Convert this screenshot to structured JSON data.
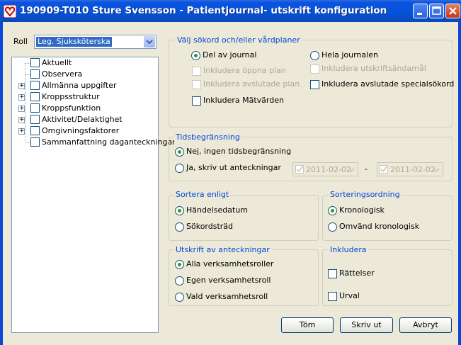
{
  "window": {
    "title": "190909-T010 Sture Svensson - Patientjournal- utskrift konfiguration"
  },
  "roll": {
    "label": "Roll",
    "selected": "Leg. Sjuksköterska"
  },
  "tree": {
    "items": [
      {
        "label": "Aktuellt",
        "expandable": false
      },
      {
        "label": "Observera",
        "expandable": false
      },
      {
        "label": "Allmänna uppgifter",
        "expandable": true
      },
      {
        "label": "Kroppsstruktur",
        "expandable": true
      },
      {
        "label": "Kroppsfunktion",
        "expandable": true
      },
      {
        "label": "Aktivitet/Delaktighet",
        "expandable": true
      },
      {
        "label": "Omgivningsfaktorer",
        "expandable": true
      },
      {
        "label": "Sammanfattning daganteckningar",
        "expandable": false
      }
    ]
  },
  "valj": {
    "title": "Välj sökord och/eller vårdplaner",
    "del_av_journal": "Del av journal",
    "hela_journalen": "Hela journalen",
    "inkl_oppna_plan": "Inkludera öppna plan",
    "inkl_utskriftsandamal": "Inkludera utskriftsändamål",
    "inkl_avslutade_plan": "Inkludera avslutade plan",
    "inkl_avslutade_specialsokord": "Inkludera avslutade specialsökord",
    "inkl_matvarden": "Inkludera Mätvärden"
  },
  "tid": {
    "title": "Tidsbegränsning",
    "nej": "Nej, ingen tidsbegränsning",
    "ja": "Ja, skriv ut anteckningar",
    "from_date": "2011-02-02",
    "dash": "-",
    "to_date": "2011-02-02"
  },
  "sortera": {
    "title": "Sortera enligt",
    "handelsedatum": "Händelsedatum",
    "sokordstrad": "Sökordsträd"
  },
  "sortering": {
    "title": "Sorteringsordning",
    "kronologisk": "Kronologisk",
    "omvand": "Omvänd kronologisk"
  },
  "utskrift": {
    "title": "Utskrift av anteckningar",
    "alla": "Alla verksamhetsroller",
    "egen": "Egen verksamhetsroll",
    "vald": "Vald verksamhetsroll"
  },
  "inkludera": {
    "title": "Inkludera",
    "rattelser": "Rättelser",
    "urval": "Urval"
  },
  "buttons": {
    "tom": "Töm",
    "skriv_ut": "Skriv ut",
    "avbryt": "Avbryt"
  }
}
